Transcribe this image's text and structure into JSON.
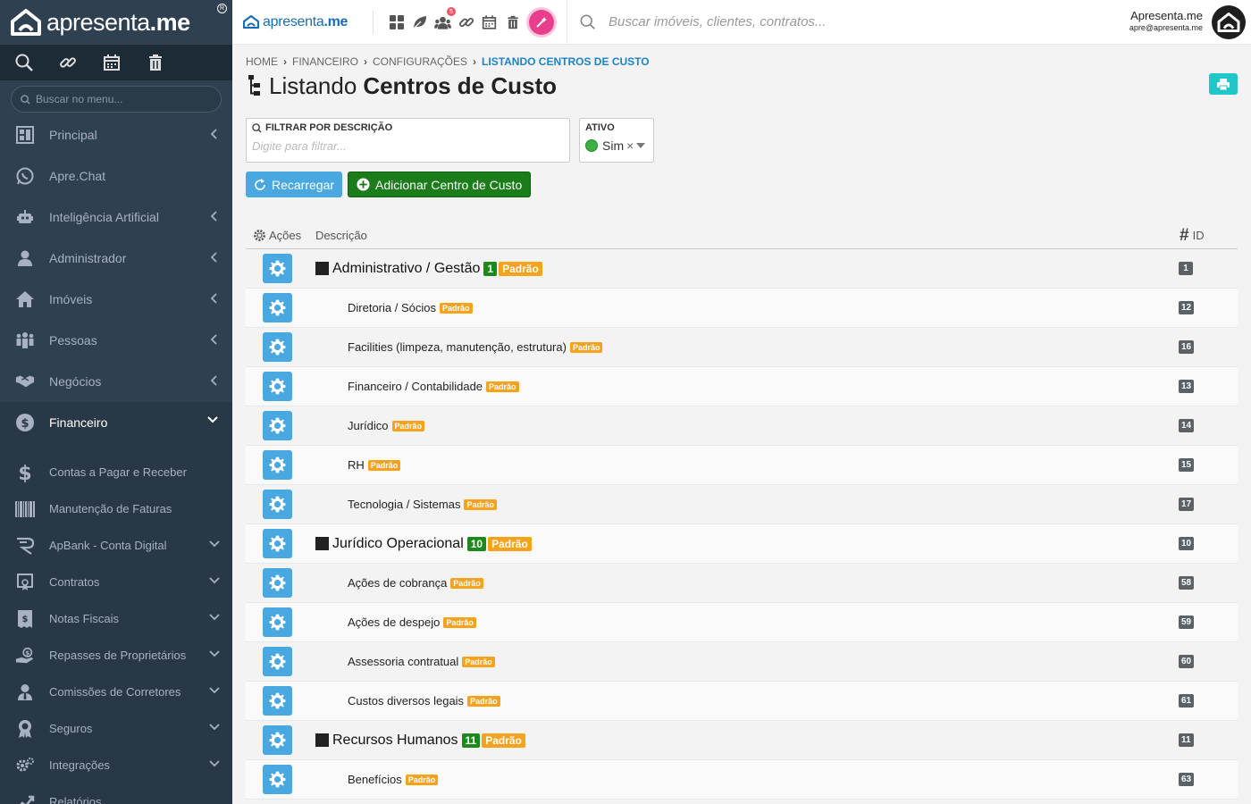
{
  "app": {
    "logo_text": "apresenta",
    "logo_suffix": ".me",
    "topbar_logo": "apresenta",
    "topbar_logo_suffix": ".me"
  },
  "sidebar": {
    "search_placeholder": "Buscar no menu...",
    "tools": [
      "search-icon",
      "link-icon",
      "calendar-icon",
      "trash-icon"
    ],
    "items": [
      {
        "label": "Principal",
        "icon": "dashboard-icon",
        "chevron": "left"
      },
      {
        "label": "Apre.Chat",
        "icon": "whatsapp-icon",
        "chevron": ""
      },
      {
        "label": "Inteligência Artificial",
        "icon": "robot-icon",
        "chevron": "left"
      },
      {
        "label": "Administrador",
        "icon": "user-icon",
        "chevron": "left"
      },
      {
        "label": "Imóveis",
        "icon": "home-icon",
        "chevron": "left"
      },
      {
        "label": "Pessoas",
        "icon": "people-icon",
        "chevron": "left"
      },
      {
        "label": "Negócios",
        "icon": "handshake-icon",
        "chevron": "left"
      },
      {
        "label": "Financeiro",
        "icon": "dollar-circle-icon",
        "chevron": "down",
        "active": true
      }
    ],
    "subitems": [
      {
        "label": "Contas a Pagar e Receber",
        "icon": "dollar-icon",
        "chevron": ""
      },
      {
        "label": "Manutenção de Faturas",
        "icon": "barcode-icon",
        "chevron": ""
      },
      {
        "label": "ApBank - Conta Digital",
        "icon": "bank-icon",
        "chevron": "down"
      },
      {
        "label": "Contratos",
        "icon": "contract-icon",
        "chevron": "down"
      },
      {
        "label": "Notas Fiscais",
        "icon": "invoice-icon",
        "chevron": "down"
      },
      {
        "label": "Repasses de Proprietários",
        "icon": "hand-coin-icon",
        "chevron": "down"
      },
      {
        "label": "Comissões de Corretores",
        "icon": "user-tie-icon",
        "chevron": "down"
      },
      {
        "label": "Seguros",
        "icon": "award-icon",
        "chevron": "down"
      },
      {
        "label": "Integrações",
        "icon": "cogs-icon",
        "chevron": "down"
      },
      {
        "label": "Relatórios",
        "icon": "chart-icon",
        "chevron": ""
      }
    ]
  },
  "topbar": {
    "notification_count": "5",
    "search_placeholder": "Buscar imóveis, clientes, contratos...",
    "user_name": "Apresenta.me",
    "user_email": "apre@apresenta.me"
  },
  "breadcrumb": [
    "HOME",
    "FINANCEIRO",
    "CONFIGURAÇÕES",
    "LISTANDO CENTROS DE CUSTO"
  ],
  "page": {
    "title_light": "Listando",
    "title_bold": "Centros de Custo"
  },
  "filters": {
    "description_label": "FILTRAR POR DESCRIÇÃO",
    "description_placeholder": "Digite para filtrar...",
    "active_label": "ATIVO",
    "active_value": "Sim"
  },
  "buttons": {
    "reload": "Recarregar",
    "add": "Adicionar Centro de Custo"
  },
  "table": {
    "col_actions": "Ações",
    "col_description": "Descrição",
    "col_id": "ID",
    "badge_default": "Padrão",
    "rows": [
      {
        "type": "parent",
        "name": "Administrativo / Gestão",
        "count": "1",
        "id": "1"
      },
      {
        "type": "child",
        "name": "Diretoria / Sócios",
        "id": "12"
      },
      {
        "type": "child",
        "name": "Facilities (limpeza, manutenção, estrutura)",
        "id": "16"
      },
      {
        "type": "child",
        "name": "Financeiro / Contabilidade",
        "id": "13"
      },
      {
        "type": "child",
        "name": "Jurídico",
        "id": "14"
      },
      {
        "type": "child",
        "name": "RH",
        "id": "15"
      },
      {
        "type": "child",
        "name": "Tecnologia / Sistemas",
        "id": "17"
      },
      {
        "type": "parent",
        "name": "Jurídico Operacional",
        "count": "10",
        "id": "10"
      },
      {
        "type": "child",
        "name": "Ações de cobrança",
        "id": "58"
      },
      {
        "type": "child",
        "name": "Ações de despejo",
        "id": "59"
      },
      {
        "type": "child",
        "name": "Assessoria contratual",
        "id": "60"
      },
      {
        "type": "child",
        "name": "Custos diversos legais",
        "id": "61"
      },
      {
        "type": "parent",
        "name": "Recursos Humanos",
        "count": "11",
        "id": "11"
      },
      {
        "type": "child",
        "name": "Benefícios",
        "id": "63"
      }
    ]
  },
  "colors": {
    "sidebar_bg": "#2f4050",
    "accent_blue": "#4aa8e0",
    "green": "#1a7d1a",
    "badge_orange": "#f7a21b",
    "id_badge": "#5a6268",
    "print_button": "#23c6c8"
  }
}
